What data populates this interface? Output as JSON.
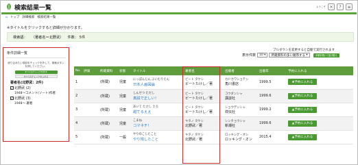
{
  "header": {
    "title": "検索結果一覧",
    "small_text": "ようこそ",
    "buttons": [
      "×",
      "?",
      "≡"
    ]
  },
  "breadcrumb": [
    "トップ",
    "詳細検索",
    "検索結果一覧"
  ],
  "note": "※タイトルをクリックすると詳細が分かります。",
  "conditions": {
    "label": "検索語：",
    "value": "（著者名＝北野武）",
    "count": "件数： 5件"
  },
  "sidebar": {
    "heading": "条件詳細一覧",
    "description": "絞り込みたい項目をチェックを外して、検索ボタンを押してください。",
    "apply_button": "すべてのチェックを外す",
    "clear_button": "すべてのチェックを入れる",
    "facet_title": "著者名(北野武：2件)",
    "facets": [
      {
        "label": "北野武 (2)",
        "checked": true,
        "sub": "1948～コメント(ソート)作者"
      },
      {
        "label": "北野武 (3)",
        "checked": true,
        "sub": "1948～ 著者"
      }
    ]
  },
  "sort": {
    "note": "プルダウンを変更すると自動で実行されます",
    "display_label": "表示件数",
    "display_value": "10",
    "order_value": "所蔵資料の多い順序する",
    "apply": "手順を開いて並び替え"
  },
  "table": {
    "headers": [
      "No.",
      "評価",
      "所蔵資料",
      "状態",
      "タイトル",
      "著者名",
      "出版者",
      "出版年",
      "予約に入れる"
    ],
    "rows": [
      {
        "no": "1",
        "status": "(所蔵)",
        "kind": "児童",
        "title_kana": "にっぽんじん ぶいむりえん",
        "title": "日本人画図論",
        "author_kana": "ビート タケシ",
        "author": "ビートたけし／著",
        "pub_kana": "カドカワショテン",
        "publisher": "角川書店",
        "year": "1999.5",
        "btn": "予約に入れる"
      },
      {
        "no": "2",
        "status": "(所蔵)",
        "kind": "児童",
        "title_kana": "しんせつ ただし",
        "title": "真説で正しい！",
        "author_kana": "ビート タケシ",
        "author": "ビートたけし／著",
        "pub_kana": "コウダンシャ",
        "publisher": "講談社",
        "year": "1999.6",
        "btn": "予約に入れる"
      },
      {
        "no": "3",
        "status": "(所蔵)",
        "kind": "児童",
        "title_kana": "あいて たけし えろ",
        "title": "甜てるええ",
        "author_kana": "ビート タケシ",
        "author": "ビートたけし／著",
        "pub_kana": "ショウデンシャ",
        "publisher": "祥伝社",
        "year": "1999.2",
        "btn": "予約に入れる"
      },
      {
        "no": "4",
        "status": "(所蔵)",
        "kind": "児童",
        "title_kana": "こまね",
        "title": "コマネチ！",
        "author_kana": "キタノ タケシ",
        "author": "北野武／著",
        "pub_kana": "シンチョウシャ",
        "publisher": "新潮社",
        "year": "1999.6",
        "btn": "予約に入れる"
      },
      {
        "no": "5",
        "status": "(所蔵)",
        "kind": "一般",
        "title_kana": "やりのこしたこと",
        "title": "やり残したこと",
        "author_kana": "キタノ タケシ",
        "author": "北野武／著",
        "pub_kana": "ロッキング・オン",
        "publisher": "ロッキング・オン",
        "year": "2015.4",
        "btn": "予約に入れる"
      }
    ]
  }
}
